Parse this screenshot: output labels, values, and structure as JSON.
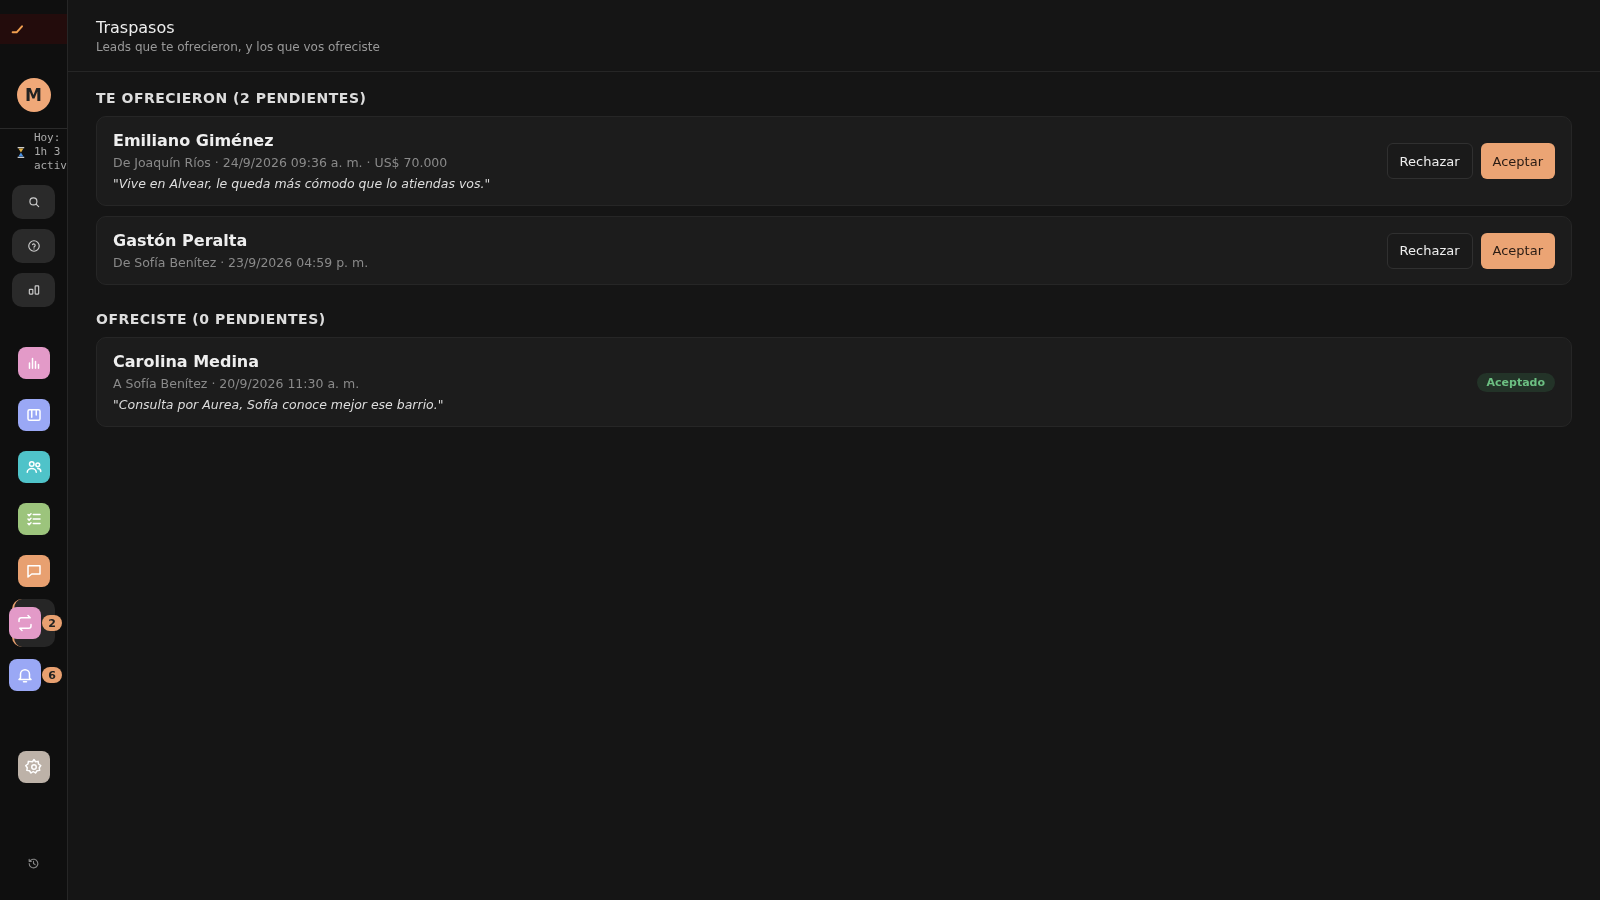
{
  "sidebar": {
    "avatar": "M",
    "timer": {
      "lines": [
        "Hoy:",
        "1h 3",
        "activ"
      ]
    },
    "tools": [
      {
        "kind": "search"
      },
      {
        "kind": "help"
      },
      {
        "kind": "stats"
      }
    ],
    "nav": [
      {
        "kind": "chart",
        "color": "#e39ac8",
        "selected": false
      },
      {
        "kind": "board",
        "color": "#9aa8f5",
        "selected": false
      },
      {
        "kind": "people",
        "color": "#4fc3c9",
        "selected": false
      },
      {
        "kind": "tasks",
        "color": "#9cc47c",
        "selected": false
      },
      {
        "kind": "chat",
        "color": "#e8a070",
        "selected": false
      },
      {
        "kind": "transfer",
        "color": "#e39ac8",
        "selected": true,
        "badge": "2"
      },
      {
        "kind": "bell",
        "color": "#9aa8f5",
        "selected": false,
        "badge": "6"
      }
    ],
    "settings": {
      "color": "#bdb2a8"
    }
  },
  "header": {
    "title": "Traspasos",
    "subtitle": "Leads que te ofrecieron, y los que vos ofreciste"
  },
  "sections": [
    {
      "title": "TE OFRECIERON (2 PENDIENTES)",
      "items": [
        {
          "name": "Emiliano Giménez",
          "meta": "De Joaquín Ríos · 24/9/2026 09:36 a. m. · US$ 70.000",
          "note": "\"Vive en Alvear, le queda más cómodo que lo atiendas vos.\"",
          "actions": [
            "Rechazar",
            "Aceptar"
          ]
        },
        {
          "name": "Gastón Peralta",
          "meta": "De Sofía Benítez · 23/9/2026 04:59 p. m.",
          "actions": [
            "Rechazar",
            "Aceptar"
          ]
        }
      ]
    },
    {
      "title": "OFRECISTE (0 PENDIENTES)",
      "items": [
        {
          "name": "Carolina Medina",
          "meta": "A Sofía Benítez · 20/9/2026 11:30 a. m.",
          "note": "\"Consulta por Aurea, Sofía conoce mejor ese barrio.\"",
          "status": "Aceptado"
        }
      ]
    }
  ]
}
